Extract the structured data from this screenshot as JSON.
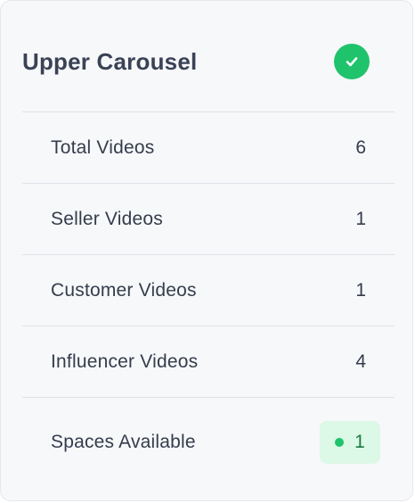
{
  "card": {
    "title": "Upper Carousel",
    "status_icon": "check-circle-icon",
    "status_color": "#1fc36b"
  },
  "stats": [
    {
      "label": "Total Videos",
      "value": "6"
    },
    {
      "label": "Seller Videos",
      "value": "1"
    },
    {
      "label": "Customer Videos",
      "value": "1"
    },
    {
      "label": "Influencer Videos",
      "value": "4"
    }
  ],
  "spaces": {
    "label": "Spaces Available",
    "value": "1",
    "badge_color": "#dcf8e6",
    "dot_color": "#1fc36b"
  }
}
